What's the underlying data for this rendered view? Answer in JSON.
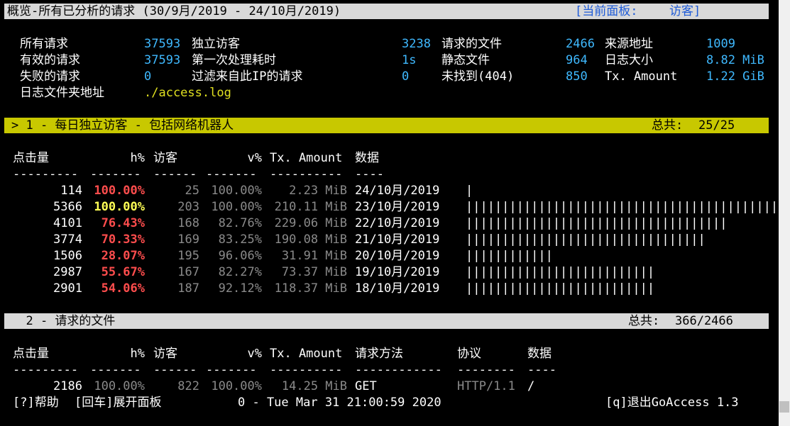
{
  "header": {
    "title": "概览-所有已分析的请求 (30/9月/2019 - 24/10月/2019)",
    "active_panel_prefix": "[当前面板:",
    "active_panel": "访客]"
  },
  "overview": {
    "col1": [
      {
        "label": "所有请求",
        "value": "37593"
      },
      {
        "label": "有效的请求",
        "value": "37593"
      },
      {
        "label": "失败的请求",
        "value": "0"
      },
      {
        "label": "日志文件夹地址",
        "value": "./access.log"
      }
    ],
    "col2": [
      {
        "label": "独立访客",
        "value": "3238"
      },
      {
        "label": "第一次处理耗时",
        "value": "1s"
      },
      {
        "label": "过滤来自此IP的请求",
        "value": "0"
      }
    ],
    "col3": [
      {
        "label": "请求的文件",
        "value": "2466"
      },
      {
        "label": "静态文件",
        "value": "964"
      },
      {
        "label": "未找到(404)",
        "value": "850"
      }
    ],
    "col4": [
      {
        "label": "来源地址",
        "value": "1009"
      },
      {
        "label": "日志大小",
        "value": "8.82 MiB"
      },
      {
        "label": "Tx. Amount",
        "value": "1.22 GiB"
      }
    ]
  },
  "panel1": {
    "title": "> 1 - 每日独立访客 - 包括网络机器人",
    "total_label": "总共:",
    "total_value": "25/25",
    "headers": {
      "hits": "点击量",
      "hp": "h%",
      "visitors": "访客",
      "vp": "v%",
      "tx": "Tx. Amount",
      "data": "数据"
    },
    "dashes": {
      "hits": "---------",
      "hp": "-------",
      "visitors": "------",
      "vp": "-------",
      "tx": "----------",
      "data": "----"
    },
    "rows": [
      {
        "hits": "114",
        "hp": "100.00%",
        "hp_color": "#ff4d4d",
        "visitors": "25",
        "vp": "100.00%",
        "tx": "2.23 MiB",
        "data": "24/10月/2019",
        "bar": 1
      },
      {
        "hits": "5366",
        "hp": "100.00%",
        "hp_color": "#ffff55",
        "visitors": "203",
        "vp": "100.00%",
        "tx": "210.11 MiB",
        "data": "23/10月/2019",
        "bar": 48
      },
      {
        "hits": "4101",
        "hp": "76.43%",
        "hp_color": "#ff4d4d",
        "visitors": "168",
        "vp": "82.76%",
        "tx": "229.06 MiB",
        "data": "22/10月/2019",
        "bar": 36
      },
      {
        "hits": "3774",
        "hp": "70.33%",
        "hp_color": "#ff4d4d",
        "visitors": "169",
        "vp": "83.25%",
        "tx": "190.08 MiB",
        "data": "21/10月/2019",
        "bar": 33
      },
      {
        "hits": "1506",
        "hp": "28.07%",
        "hp_color": "#ff4d4d",
        "visitors": "195",
        "vp": "96.06%",
        "tx": "31.91 MiB",
        "data": "20/10月/2019",
        "bar": 12
      },
      {
        "hits": "2987",
        "hp": "55.67%",
        "hp_color": "#ff4d4d",
        "visitors": "167",
        "vp": "82.27%",
        "tx": "73.37 MiB",
        "data": "19/10月/2019",
        "bar": 26
      },
      {
        "hits": "2901",
        "hp": "54.06%",
        "hp_color": "#ff4d4d",
        "visitors": "187",
        "vp": "92.12%",
        "tx": "118.37 MiB",
        "data": "18/10月/2019",
        "bar": 26
      }
    ]
  },
  "panel2": {
    "title": "  2 - 请求的文件",
    "total_label": "总共:",
    "total_value": "366/2466",
    "headers": {
      "hits": "点击量",
      "hp": "h%",
      "visitors": "访客",
      "vp": "v%",
      "tx": "Tx. Amount",
      "method": "请求方法",
      "proto": "协议",
      "data": "数据"
    },
    "dashes": {
      "hits": "---------",
      "hp": "-------",
      "visitors": "------",
      "vp": "-------",
      "tx": "----------",
      "method": "------------",
      "proto": "--------",
      "data": "----"
    },
    "rows": [
      {
        "hits": "2186",
        "hp": "100.00%",
        "visitors": "822",
        "vp": "100.00%",
        "tx": "14.25 MiB",
        "method": "GET",
        "proto": "HTTP/1.1",
        "data": "/"
      }
    ]
  },
  "footer": {
    "help": "[?]帮助",
    "enter": "[回车]展开面板",
    "status": "0 - Tue Mar 31 21:00:59 2020",
    "quit": "[q]退出GoAccess 1.3"
  },
  "colors": {
    "title_bar": "#d9d9d9",
    "panel1_bar": "#c8c800",
    "panel2_bar": "#d9d9d9"
  }
}
